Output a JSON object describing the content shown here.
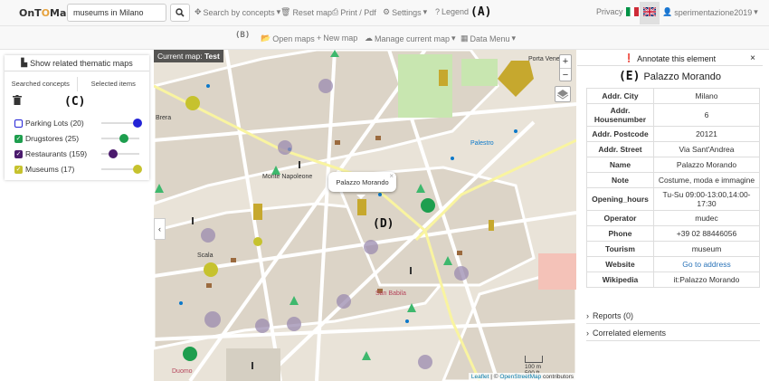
{
  "app": {
    "logo_pre": "OnT",
    "logo_pin": "O",
    "logo_post": "Map"
  },
  "search": {
    "value": "museums in Milano",
    "placeholder": "Search"
  },
  "topnav": {
    "search_concepts": "Search by concepts",
    "reset_map": "Reset map",
    "print_pdf": "Print / Pdf",
    "settings": "Settings",
    "legend": "Legend",
    "privacy": "Privacy",
    "user": "sperimentazione2019"
  },
  "secondnav": {
    "open_maps": "Open maps",
    "new_map": "New map",
    "manage_map": "Manage current map",
    "data_menu": "Data Menu"
  },
  "labels": {
    "a": "(A)",
    "b": "(B)",
    "c": "(C)",
    "d": "(D)",
    "e": "(E)"
  },
  "left": {
    "thematic_button": "Show related thematic maps",
    "tab_searched": "Searched concepts",
    "tab_selected": "Selected items",
    "layers": [
      {
        "label": "Parking Lots (20)",
        "color": "#2323d6",
        "slider": 0.95,
        "checked": false
      },
      {
        "label": "Drugstores (25)",
        "color": "#1e9e4e",
        "slider": 0.6,
        "checked": true
      },
      {
        "label": "Restaurants (159)",
        "color": "#4b1a6d",
        "slider": 0.3,
        "checked": true
      },
      {
        "label": "Museums (17)",
        "color": "#c6c22e",
        "slider": 0.95,
        "checked": true
      }
    ]
  },
  "map": {
    "current_map_prefix": "Current map:",
    "current_map_name": "Test",
    "popup": "Palazzo Morando",
    "zoom_in": "+",
    "zoom_out": "−",
    "attribution_leaflet": "Leaflet",
    "attribution_sep": "| ©",
    "attribution_osm": "OpenStreetMap",
    "attribution_contrib": "contributors",
    "scale_m": "100 m",
    "scale_ft": "500 ft",
    "labels": [
      "Monte Napoleone",
      "San Babila",
      "Duomo",
      "Scala",
      "Porta Venezia",
      "Palestro",
      "Brera"
    ]
  },
  "right": {
    "annotate": "Annotate this element",
    "close": "×",
    "title": "Palazzo Morando",
    "rows": [
      {
        "k": "Addr. City",
        "v": "Milano"
      },
      {
        "k": "Addr. Housenumber",
        "v": "6"
      },
      {
        "k": "Addr. Postcode",
        "v": "20121"
      },
      {
        "k": "Addr. Street",
        "v": "Via Sant'Andrea"
      },
      {
        "k": "Name",
        "v": "Palazzo Morando"
      },
      {
        "k": "Note",
        "v": "Costume, moda e immagine"
      },
      {
        "k": "Opening_hours",
        "v": "Tu-Su 09:00-13:00,14:00-17:30"
      },
      {
        "k": "Operator",
        "v": "mudec"
      },
      {
        "k": "Phone",
        "v": "+39 02 88446056"
      },
      {
        "k": "Tourism",
        "v": "museum"
      },
      {
        "k": "Website",
        "v": "Go to address"
      },
      {
        "k": "Wikipedia",
        "v": "it:Palazzo Morando"
      }
    ],
    "reports": "Reports (0)",
    "correlated": "Correlated elements"
  }
}
